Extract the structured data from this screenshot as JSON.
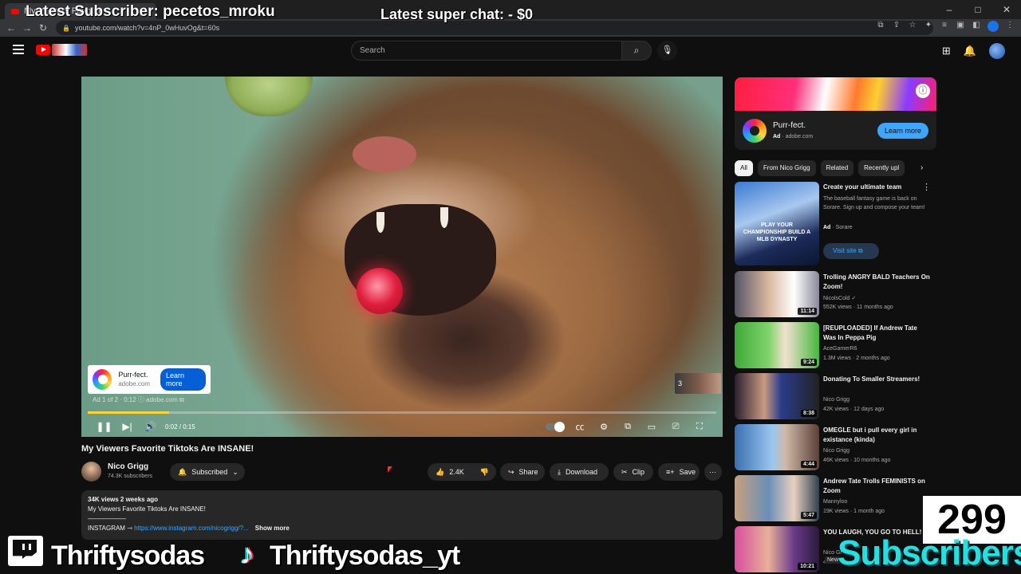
{
  "browser": {
    "tab_title": "My Viewers Favorite",
    "url": "youtube.com/watch?v=4nP_0wHuvOg&t=60s"
  },
  "overlay": {
    "latest_subscriber": "Latest Subscriber: pecetos_mroku",
    "latest_superchat": "Latest super chat:  - $0",
    "twitch_name": "Thriftysodas",
    "tiktok_name": "Thriftysodas_yt",
    "subscriber_count": "299",
    "subscribers_label": "Subscribers"
  },
  "header": {
    "search_placeholder": "Search"
  },
  "player": {
    "ad_card_title": "Purr-fect.",
    "ad_card_domain": "adobe.com",
    "ad_card_button": "Learn more",
    "ad_info": "Ad 1 of 2 · 0:12  ⓘ  adobe.com ⧉",
    "ad_queue_count": "3",
    "time": "0:02 / 0:15",
    "progress": 0.13
  },
  "video": {
    "title": "My Viewers Favorite Tiktoks Are INSANE!",
    "channel_name": "Nico Grigg",
    "channel_subs": "74.3K subscribers",
    "subscribe_label": "Subscribed",
    "likes": "2.4K",
    "share_label": "Share",
    "download_label": "Download",
    "clip_label": "Clip",
    "save_label": "Save"
  },
  "description": {
    "meta": "34K views  2 weeks ago",
    "line1": "My Viewers Favorite Tiktoks Are INSANE!",
    "line2": "——————",
    "instagram_label": "INSTAGRAM ⇾ ",
    "instagram_link": "https://www.instagram.com/nicogrigg/?...",
    "show_more": "Show more"
  },
  "sidebar": {
    "ad": {
      "title": "Purr-fect.",
      "ad_badge": "Ad",
      "domain": "adobe.com",
      "button": "Learn more"
    },
    "chips": [
      "All",
      "From Nico Grigg",
      "Related",
      "Recently upl"
    ],
    "sponsored": {
      "title": "Create your ultimate team",
      "body": "The baseball fantasy game is back on Sorare. Sign up and compose your team!",
      "ad_badge": "Ad",
      "advertiser": "Sorare",
      "button": "Visit site",
      "thumb_text": "PLAY YOUR CHAMPIONSHIP BUILD A MLB DYNASTY"
    },
    "recommendations": [
      {
        "title": "Trolling ANGRY BALD Teachers On Zoom!",
        "channel": "NicolsCold ✓",
        "views": "552K views · 11 months ago",
        "duration": "11:14"
      },
      {
        "title": "[REUPLOADED] If Andrew Tate Was In Peppa Pig",
        "channel": "AceGamerR6",
        "views": "1.3M views · 2 months ago",
        "duration": "9:24"
      },
      {
        "title": "Donating To Smaller Streamers!",
        "channel": "Nico Grigg",
        "views": "42K views · 12 days ago",
        "duration": "8:38"
      },
      {
        "title": "OMEGLE but i pull every girl in existance (kinda)",
        "channel": "Nico Grigg",
        "views": "46K views · 10 months ago",
        "duration": "4:44"
      },
      {
        "title": "Andrew Tate Trolls FEMINISTS on Zoom",
        "channel": "Mannyloo",
        "views": "19K views · 1 month ago",
        "duration": "5:47"
      },
      {
        "title": "YOU LAUGH, YOU GO TO HELL!",
        "channel": "Nico Gr",
        "views": "40K vi",
        "duration": "10:21"
      }
    ],
    "new_badge": "New"
  }
}
